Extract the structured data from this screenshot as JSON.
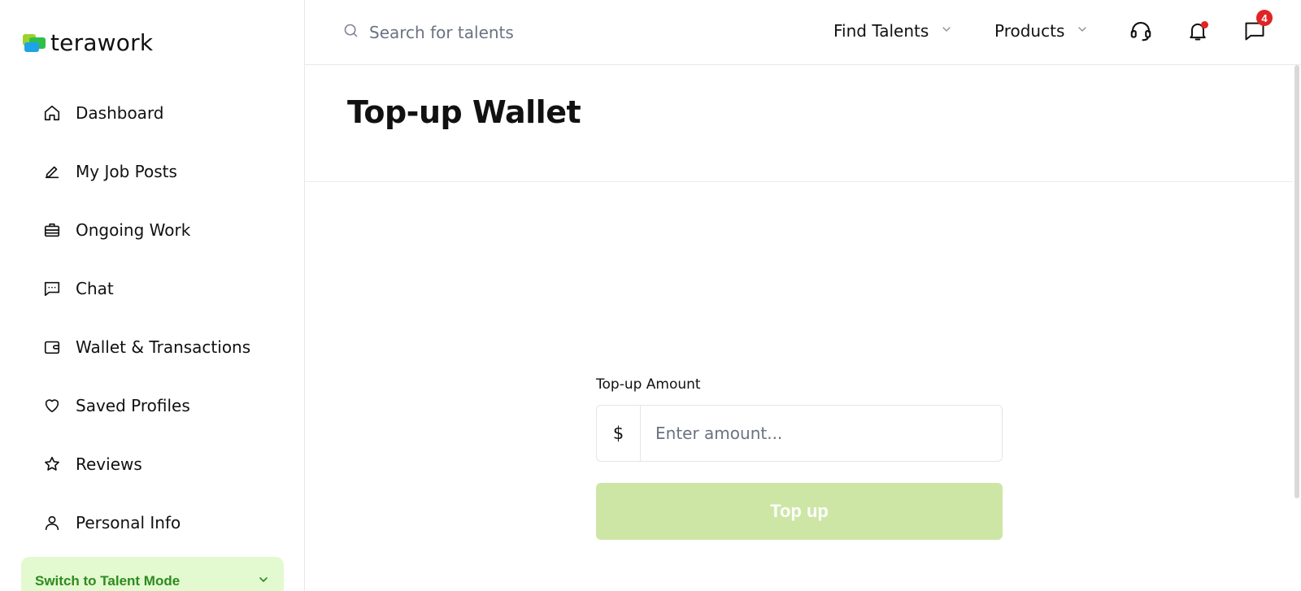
{
  "brand": {
    "name": "terawork",
    "icon": "terawork-logo-mark",
    "colors": [
      "#2fbf4a",
      "#1fa3e8",
      "#9bd32a"
    ]
  },
  "sidebar": {
    "items": [
      {
        "label": "Dashboard",
        "icon": "home-icon"
      },
      {
        "label": "My Job Posts",
        "icon": "pencil-icon"
      },
      {
        "label": "Ongoing Work",
        "icon": "briefcase-icon"
      },
      {
        "label": "Chat",
        "icon": "chat-icon"
      },
      {
        "label": "Wallet & Transactions",
        "icon": "wallet-icon"
      },
      {
        "label": "Saved Profiles",
        "icon": "heart-icon"
      },
      {
        "label": "Reviews",
        "icon": "star-icon"
      },
      {
        "label": "Personal Info",
        "icon": "user-icon"
      }
    ],
    "switch_mode": {
      "label": "Switch to Talent Mode",
      "icon": "chevron-down-icon"
    }
  },
  "topbar": {
    "search": {
      "placeholder": "Search for talents",
      "icon": "search-icon"
    },
    "menus": [
      {
        "label": "Find Talents",
        "icon": "chevron-down-icon"
      },
      {
        "label": "Products",
        "icon": "chevron-down-icon"
      }
    ],
    "icons": {
      "support": "headset-icon",
      "notifications": "bell-icon",
      "messages": "message-icon",
      "messages_badge": "4"
    }
  },
  "page": {
    "title": "Top-up Wallet",
    "form": {
      "amount_label": "Top-up Amount",
      "currency_symbol": "$",
      "amount_placeholder": "Enter amount...",
      "amount_value": "",
      "submit_label": "Top up"
    }
  },
  "colors": {
    "accent": "#2d8b1e",
    "switch_bg": "#e3f9d0",
    "button_disabled": "#cde6a6",
    "badge": "#e02424"
  }
}
